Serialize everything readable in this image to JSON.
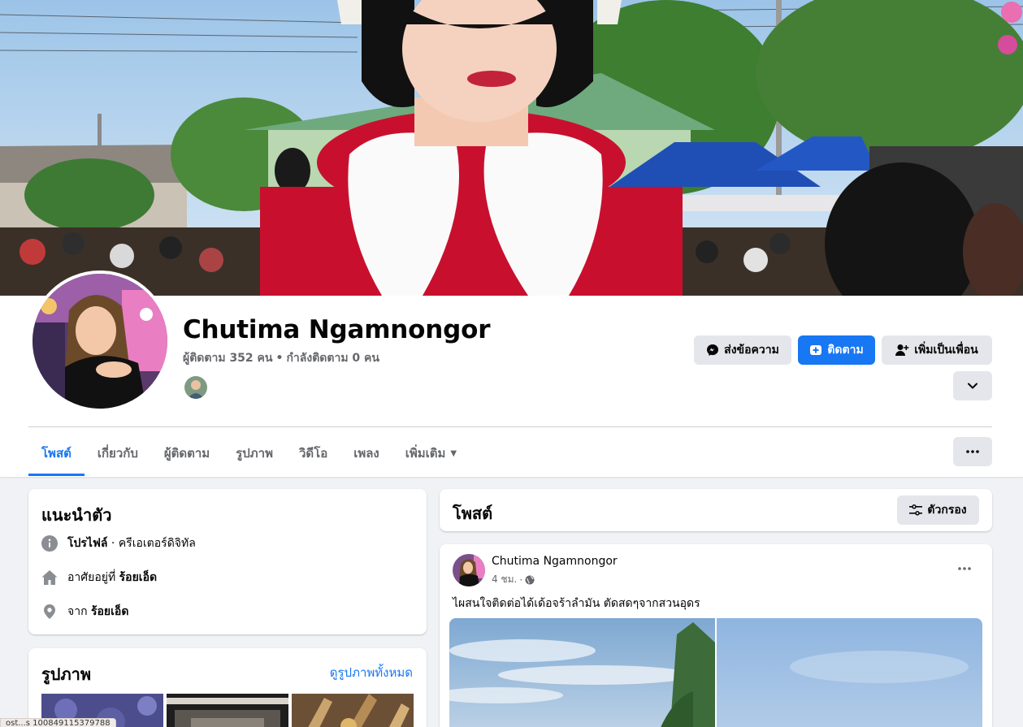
{
  "profile": {
    "name": "Chutima Ngamnongor",
    "followers": "ผู้ติดตาม 352 คน",
    "following": "กำลังติดตาม 0 คน",
    "separator": "•"
  },
  "actions": {
    "message": "ส่งข้อความ",
    "follow": "ติดตาม",
    "add_friend": "เพิ่มเป็นเพื่อน"
  },
  "tabs": [
    {
      "label": "โพสต์",
      "active": true
    },
    {
      "label": "เกี่ยวกับ"
    },
    {
      "label": "ผู้ติดตาม"
    },
    {
      "label": "รูปภาพ"
    },
    {
      "label": "วิดีโอ"
    },
    {
      "label": "เพลง"
    },
    {
      "label": "เพิ่มเติม"
    }
  ],
  "intro": {
    "title": "แนะนำตัว",
    "profile_label": "โปรไฟล์",
    "profile_desc": " · ครีเอเตอร์ดิจิทัล",
    "lives_prefix": "อาศัยอยู่ที่ ",
    "lives_city": "ร้อยเอ็ด",
    "from_prefix": "จาก ",
    "from_city": "ร้อยเอ็ด"
  },
  "photos": {
    "title": "รูปภาพ",
    "see_all": "ดูรูปภาพทั้งหมด"
  },
  "posts": {
    "title": "โพสต์",
    "filter": "ตัวกรอง"
  },
  "post": {
    "author": "Chutima Ngamnongor",
    "time": "4 ชม.",
    "dot": "·",
    "text": "ไผสนใจติดต่อได้เด้อจร้าลำมัน ตัดสดๆจากสวนอุดร"
  },
  "status_url": "ost...s 100849115379788",
  "icons": {
    "message": "messenger-icon",
    "follow": "follow-icon",
    "add_friend": "add-friend-icon",
    "expand": "chevron-down-icon",
    "more": "more-horizontal-icon",
    "info": "info-icon",
    "home": "home-icon",
    "location": "location-pin-icon",
    "filter": "filter-icon",
    "globe": "globe-icon"
  },
  "colors": {
    "brand": "#1877f2",
    "background": "#f0f2f5",
    "secondary_text": "#65676b",
    "button_gray": "#e4e6eb"
  }
}
